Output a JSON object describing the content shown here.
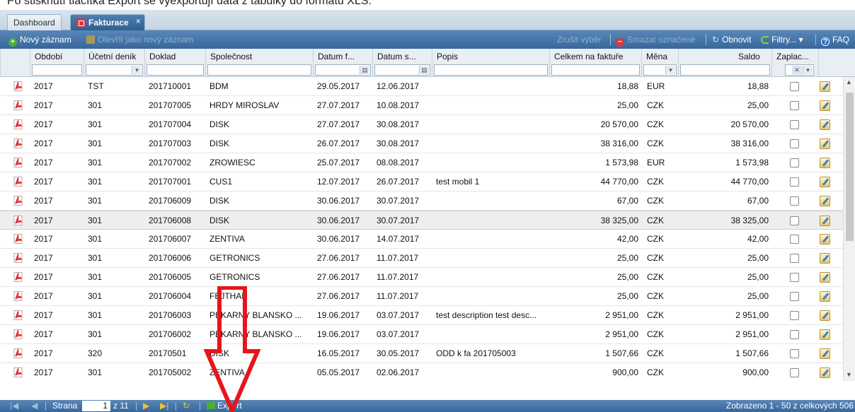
{
  "top_note": "Po stisknutí tlačítka Export se vyexportují data z tabulky do formátu XLS.",
  "tabs": [
    {
      "label": "Dashboard"
    },
    {
      "label": "Fakturace",
      "close": "×"
    }
  ],
  "toolbar": {
    "new_record": "Nový záznam",
    "open_new": "Otevřít jako nový záznam",
    "cancel_selection": "Zrušit výběr",
    "delete_selected": "Smazat označené",
    "refresh": "Obnovit",
    "filters": "Filtry...",
    "filters_arrow": "▾",
    "faq": "FAQ"
  },
  "columns": [
    "Období",
    "Účetní deník",
    "Doklad",
    "Společnost",
    "Datum f...",
    "Datum s...",
    "Popis",
    "Celkem na faktuře",
    "Měna",
    "Saldo",
    "Zaplac..."
  ],
  "filter_icons": {
    "dropdown": "▾",
    "calendar": "▤",
    "clear": "✕"
  },
  "rows": [
    {
      "obdobi": "2017",
      "denik": "TST",
      "doklad": "201710001",
      "spolecnost": "BDM",
      "datum_f": "29.05.2017",
      "datum_s": "12.06.2017",
      "popis": "",
      "celkem": "18,88",
      "mena": "EUR",
      "saldo": "18,88"
    },
    {
      "obdobi": "2017",
      "denik": "301",
      "doklad": "201707005",
      "spolecnost": "HRDY MIROSLAV",
      "datum_f": "27.07.2017",
      "datum_s": "10.08.2017",
      "popis": "",
      "celkem": "25,00",
      "mena": "CZK",
      "saldo": "25,00"
    },
    {
      "obdobi": "2017",
      "denik": "301",
      "doklad": "201707004",
      "spolecnost": "DISK",
      "datum_f": "27.07.2017",
      "datum_s": "30.08.2017",
      "popis": "",
      "celkem": "20 570,00",
      "mena": "CZK",
      "saldo": "20 570,00"
    },
    {
      "obdobi": "2017",
      "denik": "301",
      "doklad": "201707003",
      "spolecnost": "DISK",
      "datum_f": "26.07.2017",
      "datum_s": "30.08.2017",
      "popis": "",
      "celkem": "38 316,00",
      "mena": "CZK",
      "saldo": "38 316,00"
    },
    {
      "obdobi": "2017",
      "denik": "301",
      "doklad": "201707002",
      "spolecnost": "ZROWIESC",
      "datum_f": "25.07.2017",
      "datum_s": "08.08.2017",
      "popis": "",
      "celkem": "1 573,98",
      "mena": "EUR",
      "saldo": "1 573,98"
    },
    {
      "obdobi": "2017",
      "denik": "301",
      "doklad": "201707001",
      "spolecnost": "CUS1",
      "datum_f": "12.07.2017",
      "datum_s": "26.07.2017",
      "popis": "test mobil 1",
      "celkem": "44 770,00",
      "mena": "CZK",
      "saldo": "44 770,00"
    },
    {
      "obdobi": "2017",
      "denik": "301",
      "doklad": "201706009",
      "spolecnost": "DISK",
      "datum_f": "30.06.2017",
      "datum_s": "30.07.2017",
      "popis": "",
      "celkem": "67,00",
      "mena": "CZK",
      "saldo": "67,00"
    },
    {
      "obdobi": "2017",
      "denik": "301",
      "doklad": "201706008",
      "spolecnost": "DISK",
      "datum_f": "30.06.2017",
      "datum_s": "30.07.2017",
      "popis": "",
      "celkem": "38 325,00",
      "mena": "CZK",
      "saldo": "38 325,00"
    },
    {
      "obdobi": "2017",
      "denik": "301",
      "doklad": "201706007",
      "spolecnost": "ZENTIVA",
      "datum_f": "30.06.2017",
      "datum_s": "14.07.2017",
      "popis": "",
      "celkem": "42,00",
      "mena": "CZK",
      "saldo": "42,00"
    },
    {
      "obdobi": "2017",
      "denik": "301",
      "doklad": "201706006",
      "spolecnost": "GETRONICS",
      "datum_f": "27.06.2017",
      "datum_s": "11.07.2017",
      "popis": "",
      "celkem": "25,00",
      "mena": "CZK",
      "saldo": "25,00"
    },
    {
      "obdobi": "2017",
      "denik": "301",
      "doklad": "201706005",
      "spolecnost": "GETRONICS",
      "datum_f": "27.06.2017",
      "datum_s": "11.07.2017",
      "popis": "",
      "celkem": "25,00",
      "mena": "CZK",
      "saldo": "25,00"
    },
    {
      "obdobi": "2017",
      "denik": "301",
      "doklad": "201706004",
      "spolecnost": "FEJTHAR",
      "datum_f": "27.06.2017",
      "datum_s": "11.07.2017",
      "popis": "",
      "celkem": "25,00",
      "mena": "CZK",
      "saldo": "25,00"
    },
    {
      "obdobi": "2017",
      "denik": "301",
      "doklad": "201706003",
      "spolecnost": "PEKARNY BLANSKO ...",
      "datum_f": "19.06.2017",
      "datum_s": "03.07.2017",
      "popis": "test description test desc...",
      "celkem": "2 951,00",
      "mena": "CZK",
      "saldo": "2 951,00"
    },
    {
      "obdobi": "2017",
      "denik": "301",
      "doklad": "201706002",
      "spolecnost": "PEKARNY BLANSKO ...",
      "datum_f": "19.06.2017",
      "datum_s": "03.07.2017",
      "popis": "",
      "celkem": "2 951,00",
      "mena": "CZK",
      "saldo": "2 951,00"
    },
    {
      "obdobi": "2017",
      "denik": "320",
      "doklad": "20170501",
      "spolecnost": "DISK",
      "datum_f": "16.05.2017",
      "datum_s": "30.05.2017",
      "popis": "ODD k fa 201705003",
      "celkem": "1 507,66",
      "mena": "CZK",
      "saldo": "1 507,66"
    },
    {
      "obdobi": "2017",
      "denik": "301",
      "doklad": "201705002",
      "spolecnost": "ZENTIVA",
      "datum_f": "05.05.2017",
      "datum_s": "02.06.2017",
      "popis": "",
      "celkem": "900,00",
      "mena": "CZK",
      "saldo": "900,00"
    }
  ],
  "selected_row_index": 7,
  "scroll_arrows": {
    "up": "▲",
    "down": "▼"
  },
  "pager": {
    "first": "|◀",
    "prev": "◀",
    "page_label": "Strana",
    "page_value": "1",
    "page_of": "z 11",
    "next": "▶",
    "last": "▶|",
    "refresh": "↻",
    "export": "Export",
    "status": "Zobrazeno 1 - 50 z celkových 506"
  },
  "colors": {
    "accent": "#3a6a9e",
    "arrow": "#e8141c"
  }
}
